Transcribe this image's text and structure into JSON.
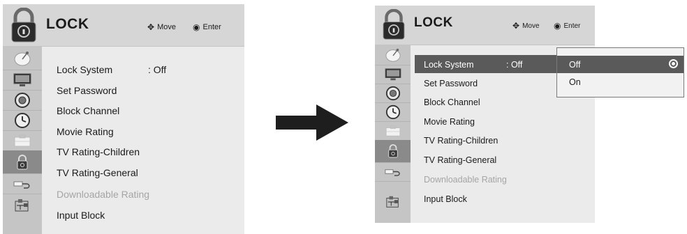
{
  "title": "LOCK",
  "hints": {
    "move": "Move",
    "enter": "Enter",
    "move_icon": "four-way-arrow-icon",
    "enter_icon": "radio-dot-icon"
  },
  "menu": {
    "items": [
      {
        "label": "Lock System",
        "value": ": Off",
        "state": "normal"
      },
      {
        "label": "Set Password",
        "state": "normal"
      },
      {
        "label": "Block Channel",
        "state": "normal"
      },
      {
        "label": "Movie Rating",
        "state": "normal"
      },
      {
        "label": "TV Rating-Children",
        "state": "normal"
      },
      {
        "label": "TV Rating-General",
        "state": "normal"
      },
      {
        "label": "Downloadable Rating",
        "state": "disabled"
      },
      {
        "label": "Input Block",
        "state": "normal"
      }
    ]
  },
  "right_value": ": Off",
  "side_icons": [
    "satellite-dish-icon",
    "monitor-icon",
    "speaker-icon",
    "clock-icon",
    "briefcase-icon",
    "lock-icon",
    "plug-icon",
    "usb-network-icon"
  ],
  "active_side_icon": "lock-icon",
  "selected_item": "Lock System",
  "dropdown": {
    "options": [
      "Off",
      "On"
    ],
    "selected": "Off"
  },
  "colors": {
    "highlight": "#5a5a5a",
    "disabled_text": "#a5a5a5",
    "panel_bg": "#ebebeb",
    "header_bg": "#d6d6d6"
  }
}
